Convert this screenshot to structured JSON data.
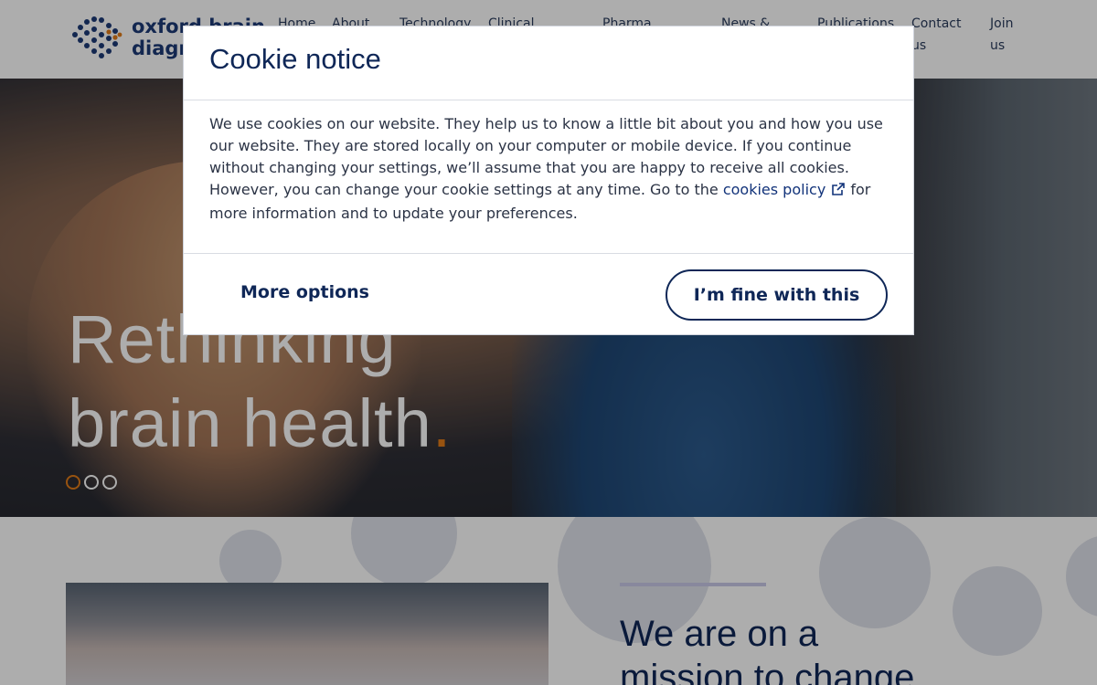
{
  "brand": {
    "logo_text_line1": "oxford brain",
    "logo_text_line2": "diagnostics"
  },
  "nav": {
    "items": [
      {
        "label": "Home"
      },
      {
        "label": "About"
      },
      {
        "label": "Technology"
      },
      {
        "label": "Clinical"
      },
      {
        "label": "Pharma"
      },
      {
        "label": "News &"
      },
      {
        "label": "Publications"
      },
      {
        "label": "Contact us"
      },
      {
        "label": "Join us"
      }
    ]
  },
  "hero": {
    "title_line1": "Rethinking",
    "title_line2": "brain health",
    "title_dot": ".",
    "slides_total": 3,
    "active_slide": 1
  },
  "mission": {
    "heading_line1": "We are on a",
    "heading_line2": "mission to change"
  },
  "cookie_modal": {
    "title": "Cookie notice",
    "body_before_link": "We use cookies on our website. They help us to know a little bit about you and how you use our website. They are stored locally on your computer or mobile device. If you continue without changing your settings, we’ll assume that you are happy to receive all cookies. However, you can change your cookie settings at any time. Go to the",
    "link_text": "cookies policy",
    "body_after_link": "for more information and to update your preferences.",
    "more_options_label": "More options",
    "accept_label": "I’m fine with this"
  },
  "colors": {
    "brand_navy": "#0f2757",
    "accent_orange": "#e07b18",
    "overlay": "rgba(0,0,0,0.32)"
  },
  "icons": {
    "logo": "brain-dots-logo-icon",
    "external_link": "external-link-icon"
  }
}
